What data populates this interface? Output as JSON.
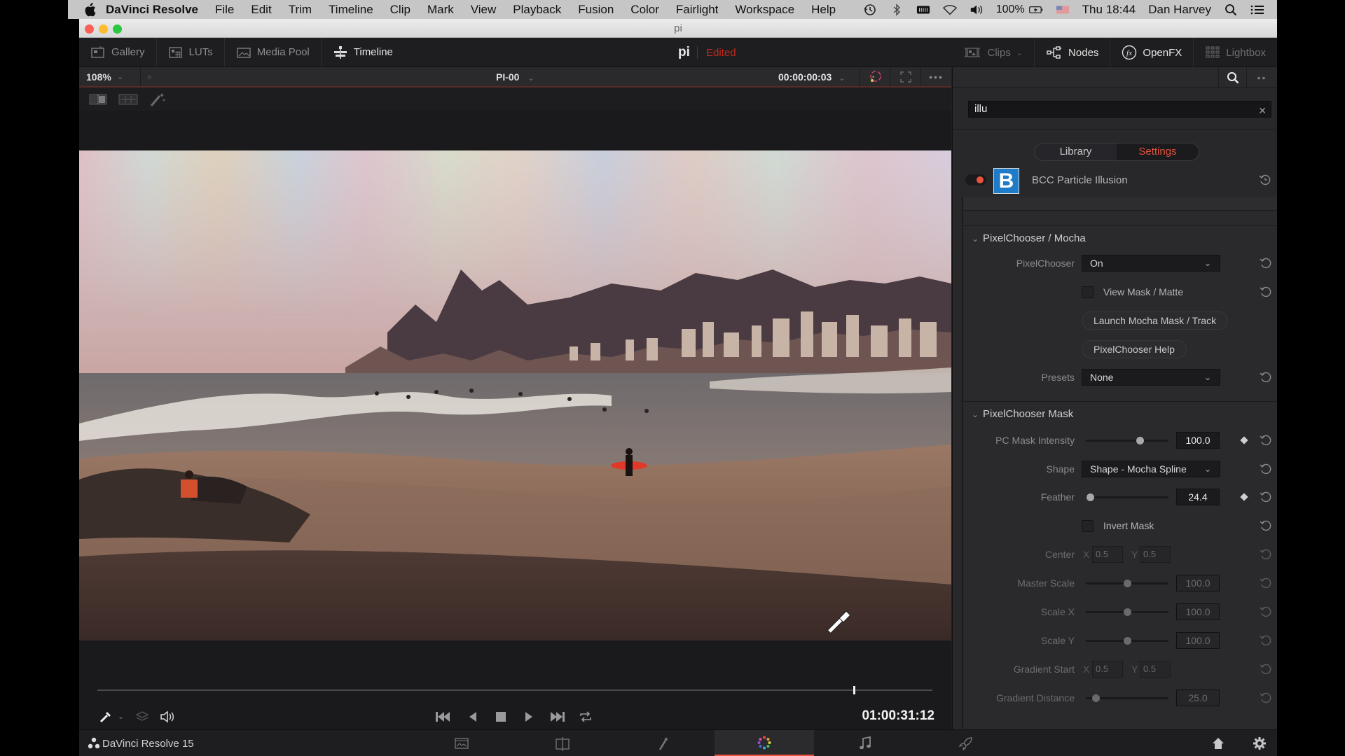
{
  "menubar": {
    "app": "DaVinci Resolve",
    "items": [
      "File",
      "Edit",
      "Trim",
      "Timeline",
      "Clip",
      "Mark",
      "View",
      "Playback",
      "Fusion",
      "Color",
      "Fairlight",
      "Workspace",
      "Help"
    ],
    "battery": "100%",
    "clock": "Thu 18:44",
    "user": "Dan Harvey",
    "status_icons": [
      "time-machine-icon",
      "bluetooth-icon",
      "battery-meter-icon",
      "wifi-icon",
      "volume-icon",
      "battery-icon",
      "flag-icon",
      "spotlight-icon",
      "notification-center-icon"
    ]
  },
  "window": {
    "title": "pi"
  },
  "toolbar": {
    "left": [
      {
        "label": "Gallery",
        "icon": "gallery-icon",
        "active": false
      },
      {
        "label": "LUTs",
        "icon": "luts-icon",
        "active": false
      },
      {
        "label": "Media Pool",
        "icon": "media-pool-icon",
        "active": false
      },
      {
        "label": "Timeline",
        "icon": "timeline-icon",
        "active": true
      }
    ],
    "project_name": "pi",
    "project_status": "Edited",
    "right": [
      {
        "label": "Clips",
        "icon": "clips-icon",
        "active": false
      },
      {
        "label": "Nodes",
        "icon": "nodes-icon",
        "active": true
      },
      {
        "label": "OpenFX",
        "icon": "openfx-icon",
        "active": true
      },
      {
        "label": "Lightbox",
        "icon": "lightbox-icon",
        "active": false
      }
    ]
  },
  "viewer": {
    "zoom": "108%",
    "clip_name": "PI-00",
    "clip_timecode": "00:00:00:03",
    "timecode": "01:00:31:12",
    "playhead_fraction": 0.906
  },
  "openfx": {
    "search_value": "illu",
    "tabs": [
      {
        "label": "Library",
        "active": false
      },
      {
        "label": "Settings",
        "active": true
      }
    ],
    "effect": {
      "name": "BCC Particle Illusion",
      "enabled": true,
      "logo_letter": "B"
    },
    "sections": [
      {
        "title": "PixelChooser / Mocha",
        "rows": {
          "pixelchooser_label": "PixelChooser",
          "pixelchooser_value": "On",
          "view_mask_label": "View Mask / Matte",
          "launch_mocha_label": "Launch Mocha Mask / Track",
          "help_label": "PixelChooser Help",
          "presets_label": "Presets",
          "presets_value": "None"
        }
      },
      {
        "title": "PixelChooser Mask",
        "rows": {
          "intensity_label": "PC Mask Intensity",
          "intensity_value": "100.0",
          "intensity_fraction": 0.65,
          "shape_label": "Shape",
          "shape_value": "Shape - Mocha Spline",
          "feather_label": "Feather",
          "feather_value": "24.4",
          "feather_fraction": 0.05,
          "invert_label": "Invert Mask",
          "center_label": "Center",
          "center_x": "0.5",
          "center_y": "0.5",
          "master_scale_label": "Master Scale",
          "master_scale_value": "100.0",
          "scale_x_label": "Scale X",
          "scale_x_value": "100.0",
          "scale_y_label": "Scale Y",
          "scale_y_value": "100.0",
          "gradient_start_label": "Gradient Start",
          "gradient_start_x": "0.5",
          "gradient_start_y": "0.5",
          "gradient_distance_label": "Gradient Distance",
          "gradient_distance_value": "25.0",
          "x_label": "X",
          "y_label": "Y"
        }
      }
    ]
  },
  "statusbar": {
    "app_label": "DaVinci Resolve 15",
    "pages": [
      "media-page-icon",
      "edit-page-icon",
      "fusion-page-icon",
      "color-page-icon",
      "fairlight-page-icon",
      "deliver-page-icon"
    ],
    "active_page": "color-page-icon"
  },
  "colors": {
    "accent": "#e8533a",
    "edited": "#c2291d",
    "effect_logo": "#1f7cc9"
  }
}
